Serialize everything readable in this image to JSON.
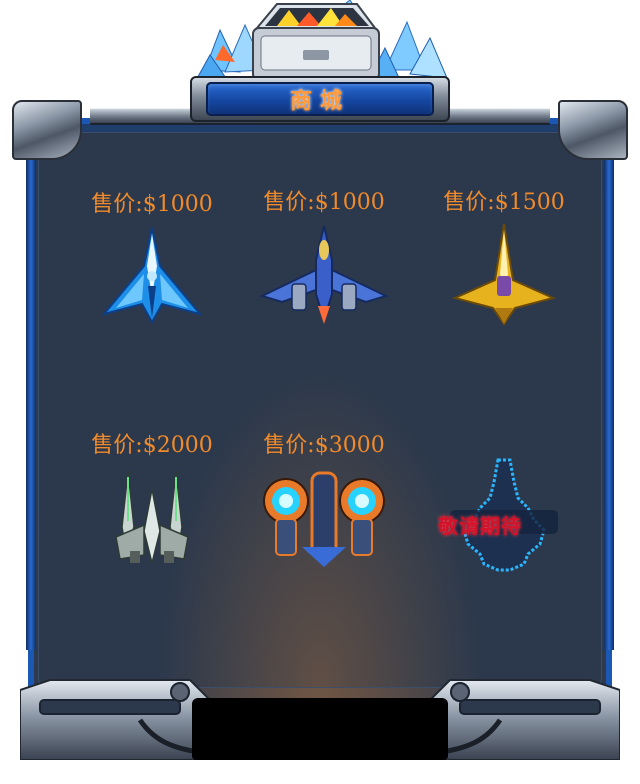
{
  "title": "商城",
  "shop_items": [
    {
      "price": "售价:$1000",
      "ship": "blue-crystal-fighter-icon",
      "accent": "#1e8fe8"
    },
    {
      "price": "售价:$1000",
      "ship": "blue-jet-fighter-icon",
      "accent": "#3a5fc8"
    },
    {
      "price": "售价:$1500",
      "ship": "gold-spear-fighter-icon",
      "accent": "#e6b21e"
    },
    {
      "price": "售价:$2000",
      "ship": "silver-twin-fighter-icon",
      "accent": "#c7d4cf"
    },
    {
      "price": "售价:$3000",
      "ship": "orange-turbine-fighter-icon",
      "accent": "#e87a2a"
    }
  ],
  "coming_soon": {
    "text": "敬请期待",
    "icon": "locked-ship-silhouette-icon",
    "color": "#d3122b",
    "glow": "#2ab6ff"
  },
  "colors": {
    "price": "#f08a2a",
    "title": "#ff9a3c",
    "panel": "#2c394c",
    "frame_blue": "#1b58b3"
  }
}
